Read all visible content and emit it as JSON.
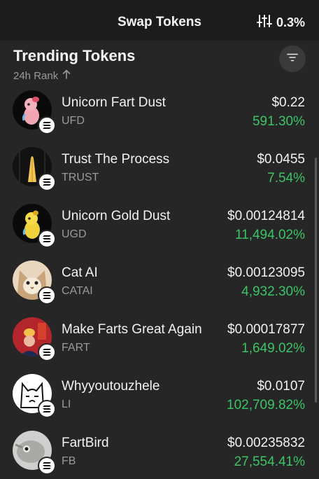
{
  "header": {
    "title": "Swap Tokens",
    "slippage": "0.3%",
    "settings_icon": "sliders-icon"
  },
  "section": {
    "title": "Trending Tokens",
    "sort_label": "24h Rank",
    "sort_icon": "arrow-up-icon",
    "filter_icon": "filter-icon"
  },
  "colors": {
    "background": "#262626",
    "header": "#1c1c1c",
    "positive": "#3cc466",
    "muted": "#9a9a9a"
  },
  "tokens": [
    {
      "name": "Unicorn Fart Dust",
      "symbol": "UFD",
      "price": "$0.22",
      "change": "591.30%"
    },
    {
      "name": "Trust The Process",
      "symbol": "TRUST",
      "price": "$0.0455",
      "change": "7.54%"
    },
    {
      "name": "Unicorn Gold Dust",
      "symbol": "UGD",
      "price": "$0.00124814",
      "change": "11,494.02%"
    },
    {
      "name": "Cat AI",
      "symbol": "CATAI",
      "price": "$0.00123095",
      "change": "4,932.30%"
    },
    {
      "name": "Make Farts Great Again",
      "symbol": "FART",
      "price": "$0.00017877",
      "change": "1,649.02%"
    },
    {
      "name": "Whyyoutouzhele",
      "symbol": "LI",
      "price": "$0.0107",
      "change": "102,709.82%"
    },
    {
      "name": "FartBird",
      "symbol": "FB",
      "price": "$0.00235832",
      "change": "27,554.41%"
    }
  ]
}
